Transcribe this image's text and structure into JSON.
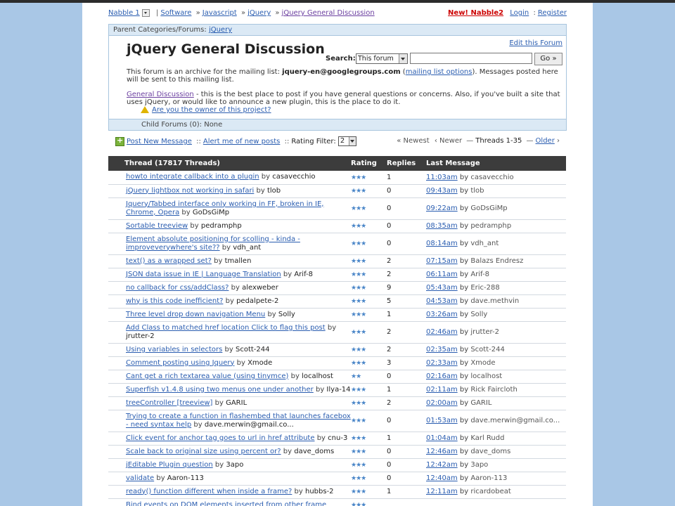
{
  "breadcrumb": {
    "nabble": "Nabble 1",
    "software": "Software",
    "javascript": "Javascript",
    "jquery": "jQuery",
    "current": "jQuery General Discussion",
    "new_nabble": "New! Nabble2",
    "login": "Login",
    "register": "Register"
  },
  "forum": {
    "parent_label": "Parent Categories/Forums:",
    "parent_link": "jQuery",
    "title": "jQuery General Discussion",
    "edit_link": "Edit this Forum",
    "search_label": "Search:",
    "search_scope": "This forum",
    "search_value": "",
    "go_label": "Go »",
    "desc_prefix": "This forum is an archive for the mailing list:",
    "mailing_list": "jquery-en@googlegroups.com",
    "options_link": "mailing list options",
    "desc_suffix": "Messages posted here will be sent to this mailing list.",
    "gd_link": "General Discussion",
    "gd_text": " - this is the best place to post if you have general questions or concerns. Also, if you've built a site that uses jQuery, or would like to announce a new plugin, this is the place to do it.",
    "owner_link": "Are you the owner of this project?",
    "child_forums": "Child Forums (0): None"
  },
  "toolbar": {
    "post_new": "Post New Message",
    "alert": "Alert me of new posts",
    "rating_label": "Rating Filter:",
    "rating_value": "2",
    "newest": "« Newest",
    "newer": "‹ Newer",
    "range": "Threads 1-35",
    "older": "Older"
  },
  "table": {
    "col_thread": "Thread (17817 Threads)",
    "col_rating": "Rating",
    "col_replies": "Replies",
    "col_last": "Last Message",
    "rows": [
      {
        "title": "howto integrate callback into a plugin",
        "author": "casavecchio",
        "stars": "★★★",
        "replies": "1",
        "time": "11:03am",
        "last": "casavecchio"
      },
      {
        "title": "jQuery lightbox not working in safari",
        "author": "tlob",
        "stars": "★★★",
        "replies": "0",
        "time": "09:43am",
        "last": "tlob"
      },
      {
        "title": "Jquery/Tabbed interface only working in FF, broken in IE, Chrome, Opera",
        "author": "GoDsGiMp",
        "stars": "★★★",
        "replies": "0",
        "time": "09:22am",
        "last": "GoDsGiMp"
      },
      {
        "title": "Sortable treeview",
        "author": "pedramphp",
        "stars": "★★★",
        "replies": "0",
        "time": "08:35am",
        "last": "pedramphp"
      },
      {
        "title": "Element absolute positioning for scolling - kinda - improveverywhere's site??",
        "author": "vdh_ant",
        "stars": "★★★",
        "replies": "0",
        "time": "08:14am",
        "last": "vdh_ant"
      },
      {
        "title": "text() as a wrapped set?",
        "author": "tmallen",
        "stars": "★★★",
        "replies": "2",
        "time": "07:15am",
        "last": "Balazs Endresz"
      },
      {
        "title": "JSON data issue in IE | Language Translation",
        "author": "Arif-8",
        "stars": "★★★",
        "replies": "2",
        "time": "06:11am",
        "last": "Arif-8"
      },
      {
        "title": "no callback for css/addClass?",
        "author": "alexweber",
        "stars": "★★★",
        "replies": "9",
        "time": "05:43am",
        "last": "Eric-288"
      },
      {
        "title": "why is this code inefficient?",
        "author": "pedalpete-2",
        "stars": "★★★",
        "replies": "5",
        "time": "04:53am",
        "last": "dave.methvin"
      },
      {
        "title": "Three level drop down navigation Menu",
        "author": "Solly",
        "stars": "★★★",
        "replies": "1",
        "time": "03:26am",
        "last": "Solly"
      },
      {
        "title": "Add Class to matched href location Click to flag this post",
        "author": "jrutter-2",
        "stars": "★★★",
        "replies": "2",
        "time": "02:46am",
        "last": "jrutter-2"
      },
      {
        "title": "Using variables in selectors",
        "author": "Scott-244",
        "stars": "★★★",
        "replies": "2",
        "time": "02:35am",
        "last": "Scott-244"
      },
      {
        "title": "Comment posting using Jquery",
        "author": "Xmode",
        "stars": "★★★",
        "replies": "3",
        "time": "02:33am",
        "last": "Xmode"
      },
      {
        "title": "Cant get a rich textarea value (using tinymce)",
        "author": "localhost",
        "stars": "★★",
        "replies": "0",
        "time": "02:16am",
        "last": "localhost"
      },
      {
        "title": "Superfish v1.4.8 using two menus one under another",
        "author": "Ilya-14",
        "stars": "★★★",
        "replies": "1",
        "time": "02:11am",
        "last": "Rick Faircloth"
      },
      {
        "title": "treeController [treeview]",
        "author": "GARIL",
        "stars": "★★★",
        "replies": "2",
        "time": "02:00am",
        "last": "GARIL"
      },
      {
        "title": "Trying to create a function in flashembed that launches facebox - need syntax help",
        "author": "dave.merwin@gmail.co...",
        "stars": "★★★",
        "replies": "0",
        "time": "01:53am",
        "last": "dave.merwin@gmail.co..."
      },
      {
        "title": "Click event for anchor tag goes to url in href attribute",
        "author": "cnu-3",
        "stars": "★★★",
        "replies": "1",
        "time": "01:04am",
        "last": "Karl Rudd"
      },
      {
        "title": "Scale back to original size using percent or?",
        "author": "dave_doms",
        "stars": "★★★",
        "replies": "0",
        "time": "12:46am",
        "last": "dave_doms"
      },
      {
        "title": "jEditable Plugin question",
        "author": "3apo",
        "stars": "★★★",
        "replies": "0",
        "time": "12:42am",
        "last": "3apo"
      },
      {
        "title": "validate",
        "author": "Aaron-113",
        "stars": "★★★",
        "replies": "0",
        "time": "12:40am",
        "last": "Aaron-113"
      },
      {
        "title": "ready() function different when inside a frame?",
        "author": "hubbs-2",
        "stars": "★★★",
        "replies": "1",
        "time": "12:11am",
        "last": "ricardobeat"
      },
      {
        "title": "Bind events on DOM elements inserted from other frame",
        "author": "",
        "stars": "★★★",
        "replies": "",
        "time": "",
        "last": ""
      }
    ]
  }
}
